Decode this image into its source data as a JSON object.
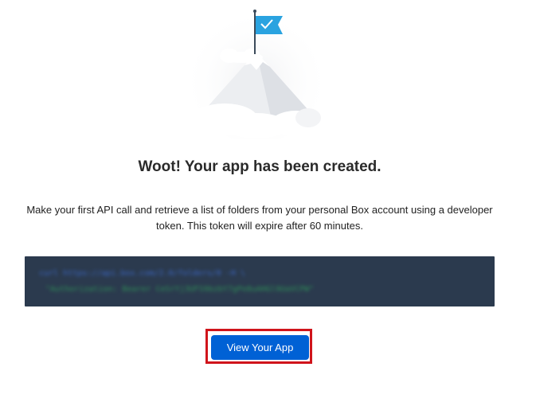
{
  "success_page": {
    "headline": "Woot! Your app has been created.",
    "description": "Make your first API call and retrieve a list of folders from your personal Box account using a developer token. This token will expire after 60 minutes.",
    "code_snippet": {
      "line1": "curl https://api.box.com/2.0/folders/0 -H \\",
      "line2": "\"Authorization: Bearer CeSrYj3UFS9bzbY7gPe8uAHGl9UaVCPW\""
    },
    "primary_button_label": "View Your App"
  },
  "colors": {
    "button_bg": "#0061d5",
    "code_bg": "#2b3a4e",
    "flag": "#2aa3e0",
    "highlight_border": "#d0141b"
  },
  "icons": [
    "mountain-flag-illustration",
    "checkmark-icon"
  ]
}
